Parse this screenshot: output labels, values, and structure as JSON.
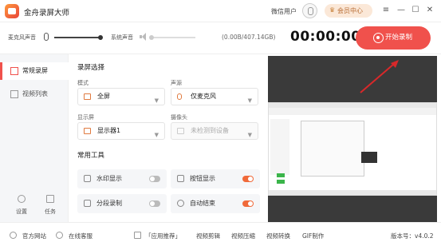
{
  "app": {
    "title": "金舟录屏大师"
  },
  "header": {
    "user_name": "微信用户",
    "vip_label": "会员中心"
  },
  "recording": {
    "mic_label": "麦克风声音",
    "system_label": "系统声音",
    "mic_volume": 1.0,
    "system_volume": 0.0,
    "storage": "(0.00B/407.14GB)",
    "timer": "00:00:00",
    "start_label": "开始录制"
  },
  "sidebar": {
    "items": [
      {
        "label": "常规录屏",
        "active": true
      },
      {
        "label": "视频列表",
        "active": false
      }
    ],
    "bottom": [
      {
        "label": "设置"
      },
      {
        "label": "任务"
      }
    ]
  },
  "settings": {
    "section_title": "录屏选择",
    "fields": {
      "mode": {
        "label": "模式",
        "value": "全屏"
      },
      "audio": {
        "label": "声源",
        "value": "仅麦克风"
      },
      "display": {
        "label": "显示屏",
        "value": "显示器1"
      },
      "camera": {
        "label": "摄像头",
        "value": "未检测到设备"
      }
    },
    "tools_title": "常用工具",
    "tools": [
      {
        "label": "水印显示",
        "on": false
      },
      {
        "label": "按钮显示",
        "on": true
      },
      {
        "label": "分段录制",
        "on": false
      },
      {
        "label": "自动结束",
        "on": true
      }
    ]
  },
  "footer": {
    "links": [
      "官方网站",
      "在线客服"
    ],
    "recommend": "「应用推荐」",
    "apps": [
      "视频剪辑",
      "视频压缩",
      "视频转换",
      "GIF制作"
    ],
    "version": "版本号：v4.0.2"
  },
  "colors": {
    "accent": "#f0514c",
    "toggle_on": "#f06a3a",
    "vip_bg": "#fbe8d8"
  }
}
